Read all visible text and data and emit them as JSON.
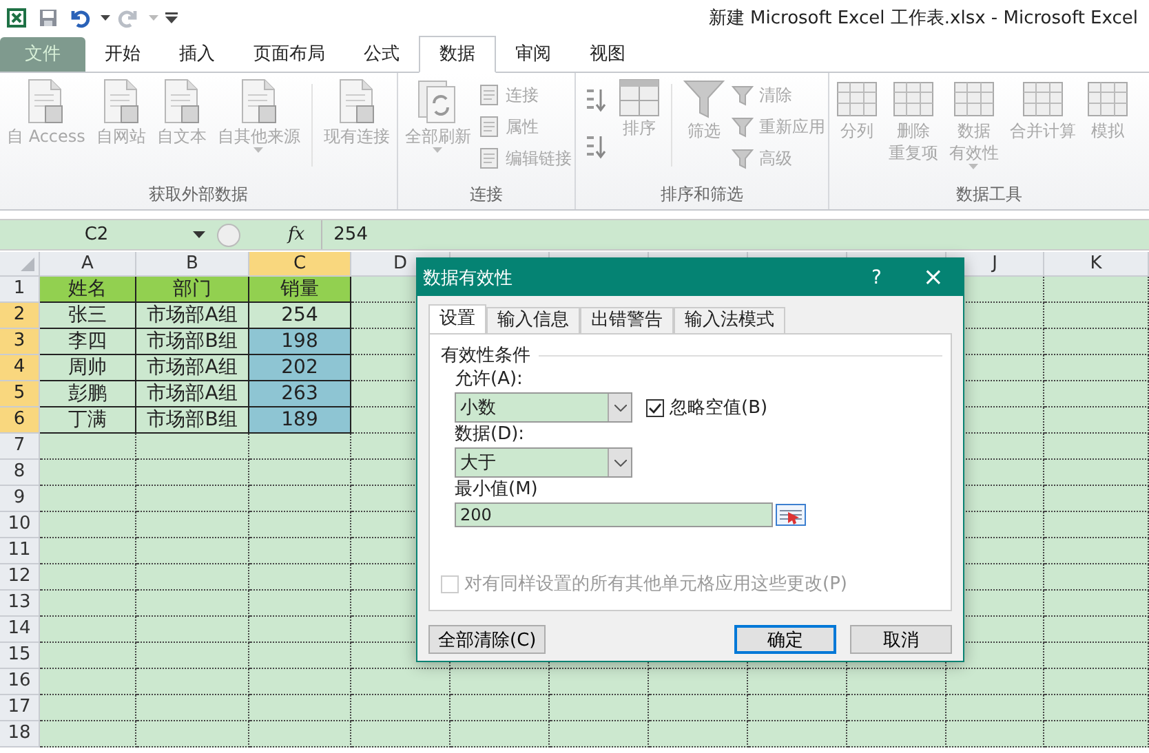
{
  "window": {
    "title": "新建 Microsoft Excel 工作表.xlsx  -  Microsoft Excel"
  },
  "tabs": [
    {
      "label": "文件",
      "kind": "file",
      "selected": false
    },
    {
      "label": "开始",
      "kind": "tab",
      "selected": false
    },
    {
      "label": "插入",
      "kind": "tab",
      "selected": false
    },
    {
      "label": "页面布局",
      "kind": "tab",
      "selected": false
    },
    {
      "label": "公式",
      "kind": "tab",
      "selected": false
    },
    {
      "label": "数据",
      "kind": "tab",
      "selected": true
    },
    {
      "label": "审阅",
      "kind": "tab",
      "selected": false
    },
    {
      "label": "视图",
      "kind": "tab",
      "selected": false
    }
  ],
  "ribbon": {
    "groups": [
      {
        "label": "获取外部数据",
        "buttons": [
          {
            "kind": "large",
            "lines": [
              "自 Access"
            ],
            "dropdown": false
          },
          {
            "kind": "large",
            "lines": [
              "自网站"
            ],
            "dropdown": false
          },
          {
            "kind": "large",
            "lines": [
              "自文本"
            ],
            "dropdown": false
          },
          {
            "kind": "large",
            "lines": [
              "自其他来源"
            ],
            "dropdown": true
          },
          {
            "kind": "separator"
          },
          {
            "kind": "large",
            "lines": [
              "现有连接"
            ],
            "dropdown": false
          }
        ]
      },
      {
        "label": "连接",
        "buttons": [
          {
            "kind": "large",
            "lines": [
              "全部刷新"
            ],
            "dropdown": true
          },
          {
            "kind": "stack",
            "items": [
              {
                "label": "连接"
              },
              {
                "label": "属性"
              },
              {
                "label": "编辑链接"
              }
            ]
          }
        ]
      },
      {
        "label": "排序和筛选",
        "buttons": [
          {
            "kind": "sort-pair"
          },
          {
            "kind": "large",
            "lines": [
              "排序"
            ],
            "dropdown": false
          },
          {
            "kind": "separator"
          },
          {
            "kind": "large",
            "lines": [
              "筛选"
            ],
            "dropdown": false
          },
          {
            "kind": "stack",
            "items": [
              {
                "label": "清除"
              },
              {
                "label": "重新应用"
              },
              {
                "label": "高级"
              }
            ]
          }
        ]
      },
      {
        "label": "数据工具",
        "buttons": [
          {
            "kind": "large",
            "lines": [
              "分列"
            ],
            "dropdown": false
          },
          {
            "kind": "large",
            "lines": [
              "删除",
              "重复项"
            ],
            "dropdown": false
          },
          {
            "kind": "large",
            "lines": [
              "数据",
              "有效性"
            ],
            "dropdown": true
          },
          {
            "kind": "large",
            "lines": [
              "合并计算"
            ],
            "dropdown": false
          },
          {
            "kind": "large",
            "lines": [
              "模拟"
            ],
            "dropdown": false
          }
        ]
      }
    ]
  },
  "formula_bar": {
    "name_box": "C2",
    "function_label": "fx",
    "value": "254"
  },
  "sheet": {
    "columns": [
      {
        "label": "A",
        "selected": false
      },
      {
        "label": "B",
        "selected": false
      },
      {
        "label": "C",
        "selected": true
      },
      {
        "label": "D",
        "selected": false
      },
      {
        "selected": false
      },
      {
        "selected": false
      },
      {
        "selected": false
      },
      {
        "selected": false
      },
      {
        "selected": false
      },
      {
        "label": "J",
        "selected": false
      },
      {
        "label": "K",
        "selected": false
      }
    ],
    "rows": [
      {
        "number": "1",
        "kind": "header",
        "selected": false,
        "cells": [
          {
            "text": "姓名",
            "selected": false
          },
          {
            "text": "部门",
            "selected": false
          },
          {
            "text": "销量",
            "selected": false
          }
        ]
      },
      {
        "number": "2",
        "kind": "data",
        "selected": true,
        "cells": [
          {
            "text": "张三",
            "selected": false
          },
          {
            "text": "市场部A组",
            "selected": false
          },
          {
            "text": "254",
            "selected": false
          }
        ]
      },
      {
        "number": "3",
        "kind": "data",
        "selected": true,
        "cells": [
          {
            "text": "李四",
            "selected": false
          },
          {
            "text": "市场部B组",
            "selected": false
          },
          {
            "text": "198",
            "selected": true
          }
        ]
      },
      {
        "number": "4",
        "kind": "data",
        "selected": true,
        "cells": [
          {
            "text": "周帅",
            "selected": false
          },
          {
            "text": "市场部A组",
            "selected": false
          },
          {
            "text": "202",
            "selected": true
          }
        ]
      },
      {
        "number": "5",
        "kind": "data",
        "selected": true,
        "cells": [
          {
            "text": "彭鹏",
            "selected": false
          },
          {
            "text": "市场部A组",
            "selected": false
          },
          {
            "text": "263",
            "selected": true
          }
        ]
      },
      {
        "number": "6",
        "kind": "data",
        "selected": true,
        "cells": [
          {
            "text": "丁满",
            "selected": false
          },
          {
            "text": "市场部B组",
            "selected": false
          },
          {
            "text": "189",
            "selected": true
          }
        ]
      },
      {
        "number": "7",
        "kind": "empty",
        "selected": false
      },
      {
        "number": "8",
        "kind": "empty",
        "selected": false
      },
      {
        "number": "9",
        "kind": "empty",
        "selected": false
      },
      {
        "number": "10",
        "kind": "empty",
        "selected": false
      },
      {
        "number": "11",
        "kind": "empty",
        "selected": false
      },
      {
        "number": "12",
        "kind": "empty",
        "selected": false
      },
      {
        "number": "13",
        "kind": "empty",
        "selected": false
      },
      {
        "number": "14",
        "kind": "empty",
        "selected": false
      },
      {
        "number": "15",
        "kind": "empty",
        "selected": false
      },
      {
        "number": "16",
        "kind": "empty",
        "selected": false
      },
      {
        "number": "17",
        "kind": "empty",
        "selected": false
      },
      {
        "number": "18",
        "kind": "empty",
        "selected": false
      }
    ]
  },
  "dialog": {
    "title": "数据有效性",
    "help_button": "?",
    "close_button": "×",
    "tabs": [
      {
        "label": "设置",
        "selected": true
      },
      {
        "label": "输入信息",
        "selected": false
      },
      {
        "label": "出错警告",
        "selected": false
      },
      {
        "label": "输入法模式",
        "selected": false
      }
    ],
    "section": "有效性条件",
    "fields": [
      {
        "kind": "select",
        "label": "允许(A):",
        "value": "小数",
        "checkbox": {
          "label": "忽略空值(B)",
          "checked": true
        }
      },
      {
        "kind": "select",
        "label": "数据(D):",
        "value": "大于"
      },
      {
        "kind": "input",
        "label": "最小值(M)",
        "value": "200"
      }
    ],
    "apply_all": {
      "label": "对有同样设置的所有其他单元格应用这些更改(P)",
      "checked": false,
      "disabled": true
    },
    "buttons": [
      {
        "label": "全部清除(C)",
        "default": false
      },
      {
        "label": "确定",
        "default": true
      },
      {
        "label": "取消",
        "default": false
      }
    ]
  }
}
